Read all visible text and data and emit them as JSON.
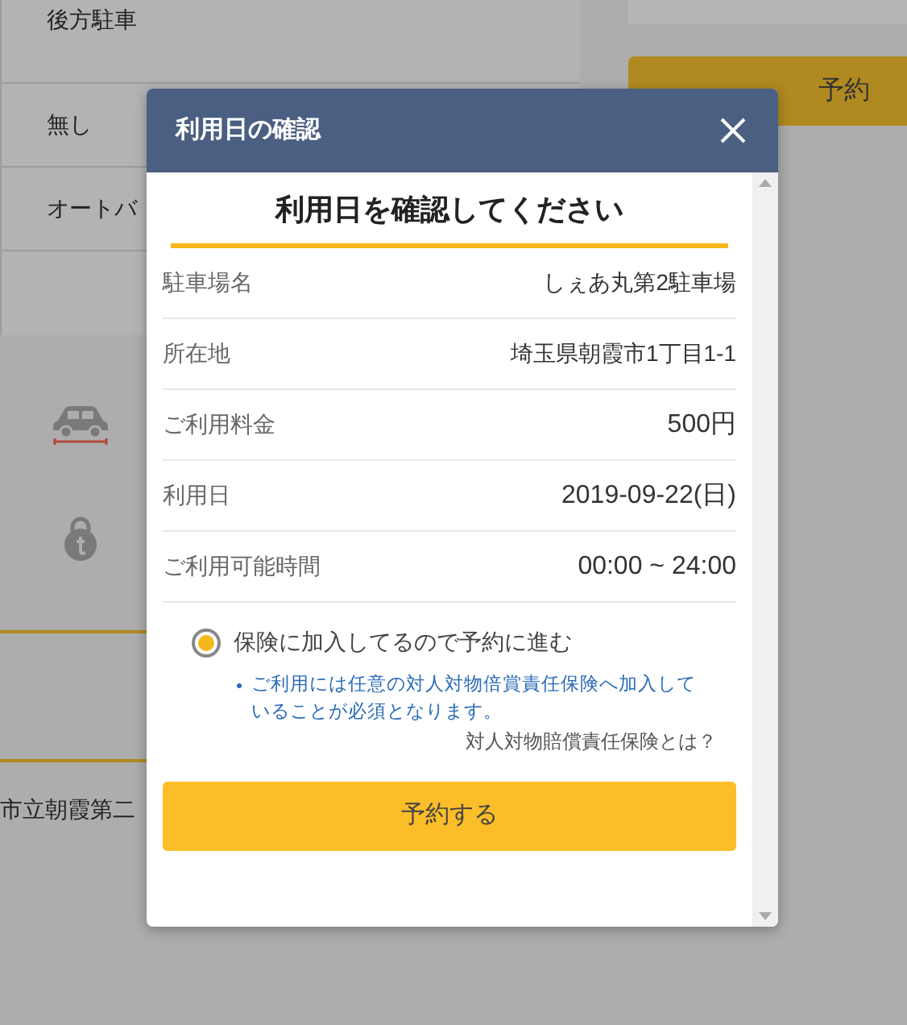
{
  "background": {
    "options": [
      "後方駐車",
      "無し",
      "オートバ"
    ],
    "features": [
      {
        "kind": "car"
      },
      {
        "kind": "lock"
      }
    ],
    "nearby": "市立朝霞第二",
    "reserve_button": "予約"
  },
  "dialog": {
    "title": "利用日の確認",
    "heading": "利用日を確認してください",
    "rows": [
      {
        "label": "駐車場名",
        "value": "しぇあ丸第2駐車場"
      },
      {
        "label": "所在地",
        "value": "埼玉県朝霞市1丁目1-1"
      },
      {
        "label": "ご利用料金",
        "value": "500円"
      },
      {
        "label": "利用日",
        "value": "2019-09-22(日)"
      },
      {
        "label": "ご利用可能時間",
        "value": "00:00 ~ 24:00"
      }
    ],
    "radio": {
      "label": "保険に加入してるので予約に進む",
      "selected": true
    },
    "note": "ご利用には任意の対人対物倍賞責任保険へ加入していることが必須となります。",
    "link": "対人対物賠償責任保険とは？",
    "button": "予約する"
  }
}
